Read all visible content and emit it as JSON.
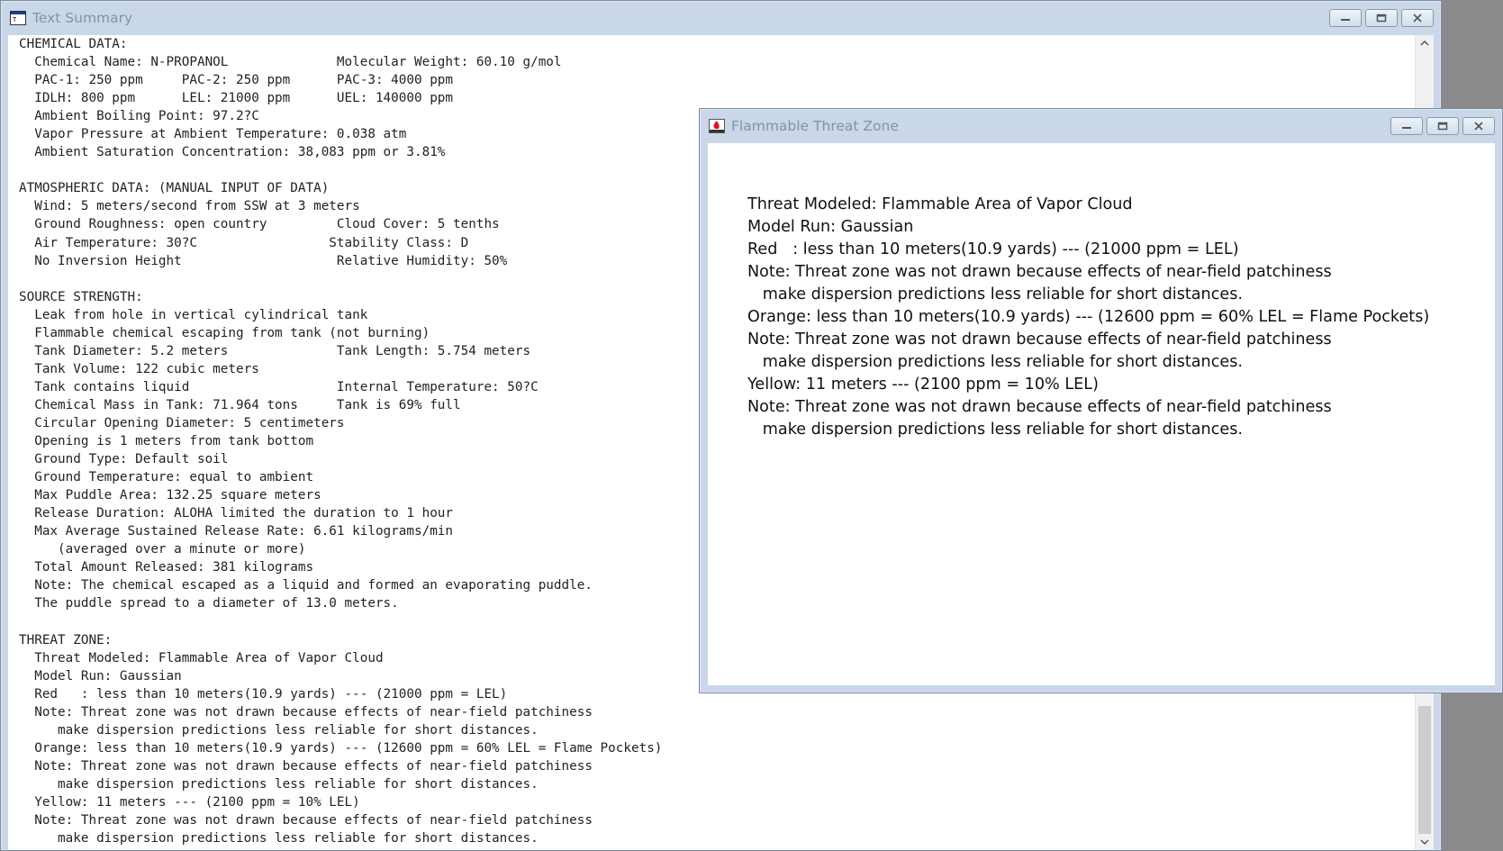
{
  "summary_window": {
    "title": "Text Summary",
    "lines": [
      "CHEMICAL DATA:",
      "  Chemical Name: N-PROPANOL              Molecular Weight: 60.10 g/mol",
      "  PAC-1: 250 ppm     PAC-2: 250 ppm      PAC-3: 4000 ppm",
      "  IDLH: 800 ppm      LEL: 21000 ppm      UEL: 140000 ppm",
      "  Ambient Boiling Point: 97.2?C",
      "  Vapor Pressure at Ambient Temperature: 0.038 atm",
      "  Ambient Saturation Concentration: 38,083 ppm or 3.81%",
      "",
      "ATMOSPHERIC DATA: (MANUAL INPUT OF DATA)",
      "  Wind: 5 meters/second from SSW at 3 meters",
      "  Ground Roughness: open country         Cloud Cover: 5 tenths",
      "  Air Temperature: 30?C                 Stability Class: D",
      "  No Inversion Height                    Relative Humidity: 50%",
      "",
      "SOURCE STRENGTH:",
      "  Leak from hole in vertical cylindrical tank",
      "  Flammable chemical escaping from tank (not burning)",
      "  Tank Diameter: 5.2 meters              Tank Length: 5.754 meters",
      "  Tank Volume: 122 cubic meters",
      "  Tank contains liquid                   Internal Temperature: 50?C",
      "  Chemical Mass in Tank: 71.964 tons     Tank is 69% full",
      "  Circular Opening Diameter: 5 centimeters",
      "  Opening is 1 meters from tank bottom",
      "  Ground Type: Default soil",
      "  Ground Temperature: equal to ambient",
      "  Max Puddle Area: 132.25 square meters",
      "  Release Duration: ALOHA limited the duration to 1 hour",
      "  Max Average Sustained Release Rate: 6.61 kilograms/min",
      "     (averaged over a minute or more)",
      "  Total Amount Released: 381 kilograms",
      "  Note: The chemical escaped as a liquid and formed an evaporating puddle.",
      "  The puddle spread to a diameter of 13.0 meters.",
      "",
      "THREAT ZONE:",
      "  Threat Modeled: Flammable Area of Vapor Cloud",
      "  Model Run: Gaussian",
      "  Red   : less than 10 meters(10.9 yards) --- (21000 ppm = LEL)",
      "  Note: Threat zone was not drawn because effects of near-field patchiness",
      "     make dispersion predictions less reliable for short distances.",
      "  Orange: less than 10 meters(10.9 yards) --- (12600 ppm = 60% LEL = Flame Pockets)",
      "  Note: Threat zone was not drawn because effects of near-field patchiness",
      "     make dispersion predictions less reliable for short distances.",
      "  Yellow: 11 meters --- (2100 ppm = 10% LEL)",
      "  Note: Threat zone was not drawn because effects of near-field patchiness",
      "     make dispersion predictions less reliable for short distances."
    ]
  },
  "threat_window": {
    "title": "Flammable Threat Zone",
    "lines": [
      "Threat Modeled: Flammable Area of Vapor Cloud",
      "Model Run: Gaussian",
      "Red   : less than 10 meters(10.9 yards) --- (21000 ppm = LEL)",
      "Note: Threat zone was not drawn because effects of near-field patchiness",
      "   make dispersion predictions less reliable for short distances.",
      "Orange: less than 10 meters(10.9 yards) --- (12600 ppm = 60% LEL = Flame Pockets)",
      "Note: Threat zone was not drawn because effects of near-field patchiness",
      "   make dispersion predictions less reliable for short distances.",
      "Yellow: 11 meters --- (2100 ppm = 10% LEL)",
      "Note: Threat zone was not drawn because effects of near-field patchiness",
      "   make dispersion predictions less reliable for short distances."
    ]
  },
  "icons": {
    "minimize": "minimize-icon",
    "maximize": "maximize-icon",
    "close": "close-icon",
    "scroll_up": "chevron-up-icon",
    "scroll_down": "chevron-down-icon"
  },
  "colors": {
    "titlebar": "#c9d7e8",
    "title_text": "#8393a6",
    "desktop": "#8a8a8a"
  }
}
